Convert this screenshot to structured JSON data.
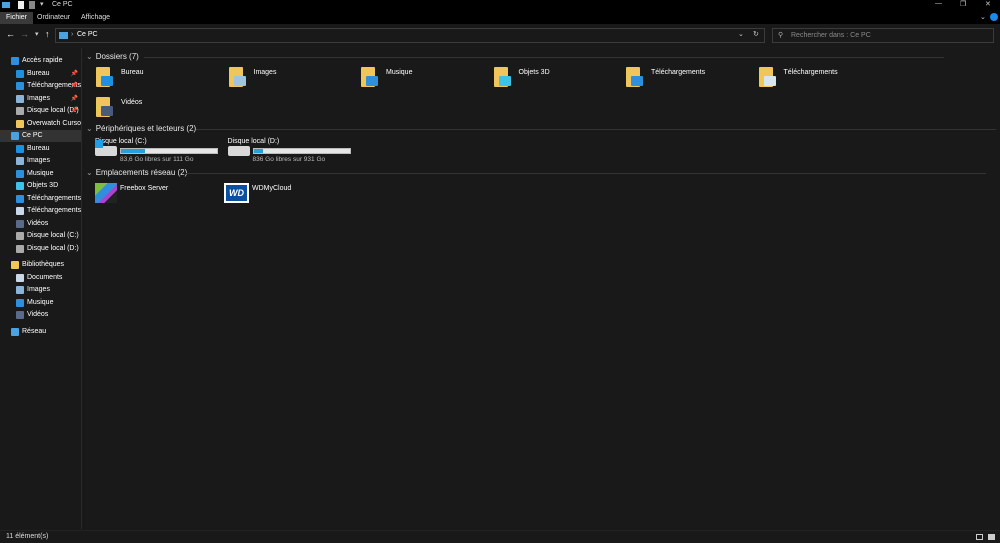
{
  "window": {
    "title": "Ce PC"
  },
  "ribbon": {
    "tabs": [
      "Fichier",
      "Ordinateur",
      "Affichage"
    ]
  },
  "address": {
    "path": "Ce PC",
    "search_placeholder": "Rechercher dans : Ce PC"
  },
  "sidebar": {
    "items": [
      {
        "label": "Accès rapide",
        "icon": "star-icon",
        "color": "#2f8fdc",
        "level": 0,
        "pinned": false
      },
      {
        "label": "Bureau",
        "icon": "desktop-icon",
        "color": "#1e90e0",
        "level": 1,
        "pinned": true
      },
      {
        "label": "Téléchargements",
        "icon": "download-icon",
        "color": "#2f8fdc",
        "level": 1,
        "pinned": true
      },
      {
        "label": "Images",
        "icon": "pictures-icon",
        "color": "#8ab4d8",
        "level": 1,
        "pinned": true
      },
      {
        "label": "Disque local (D:)",
        "icon": "drive-icon",
        "color": "#aaaaaa",
        "level": 1,
        "pinned": true
      },
      {
        "label": "Overwatch Cursor H",
        "icon": "folder-icon",
        "color": "#f0c65a",
        "level": 1,
        "pinned": false
      },
      {
        "label": "Ce PC",
        "icon": "computer-icon",
        "color": "#4aa3e0",
        "level": 0,
        "pinned": false,
        "selected": true
      },
      {
        "label": "Bureau",
        "icon": "desktop-icon",
        "color": "#1e90e0",
        "level": 1
      },
      {
        "label": "Images",
        "icon": "pictures-icon",
        "color": "#8ab4d8",
        "level": 1
      },
      {
        "label": "Musique",
        "icon": "music-icon",
        "color": "#2f8fdc",
        "level": 1
      },
      {
        "label": "Objets 3D",
        "icon": "3d-objects-icon",
        "color": "#3bc4e8",
        "level": 1
      },
      {
        "label": "Téléchargements",
        "icon": "download-icon",
        "color": "#2f8fdc",
        "level": 1
      },
      {
        "label": "Téléchargements",
        "icon": "document-icon",
        "color": "#c8d8e8",
        "level": 1
      },
      {
        "label": "Vidéos",
        "icon": "video-icon",
        "color": "#5a6a8a",
        "level": 1
      },
      {
        "label": "Disque local (C:)",
        "icon": "drive-icon",
        "color": "#aaaaaa",
        "level": 1
      },
      {
        "label": "Disque local (D:)",
        "icon": "drive-icon",
        "color": "#aaaaaa",
        "level": 1
      },
      {
        "label": "Bibliothèques",
        "icon": "libraries-icon",
        "color": "#f0c65a",
        "level": 0,
        "gap": true
      },
      {
        "label": "Documents",
        "icon": "document-icon",
        "color": "#c8d8e8",
        "level": 1
      },
      {
        "label": "Images",
        "icon": "pictures-icon",
        "color": "#8ab4d8",
        "level": 1
      },
      {
        "label": "Musique",
        "icon": "music-icon",
        "color": "#2f8fdc",
        "level": 1
      },
      {
        "label": "Vidéos",
        "icon": "video-icon",
        "color": "#5a6a8a",
        "level": 1
      },
      {
        "label": "Réseau",
        "icon": "network-icon",
        "color": "#4aa3e0",
        "level": 0,
        "gap": true
      }
    ]
  },
  "sections": {
    "folders": "Dossiers (7)",
    "drives": "Périphériques et lecteurs (2)",
    "network": "Emplacements réseau (2)"
  },
  "folders": [
    {
      "name": "Bureau",
      "overlay": "#1e90e0"
    },
    {
      "name": "Images",
      "overlay": "#9ec4e0"
    },
    {
      "name": "Musique",
      "overlay": "#2f8fdc"
    },
    {
      "name": "Objets 3D",
      "overlay": "#3bc4e8"
    },
    {
      "name": "Téléchargements",
      "overlay": "#2f8fdc"
    },
    {
      "name": "Téléchargements",
      "overlay": "#d8e4f0"
    },
    {
      "name": "Vidéos",
      "overlay": "#4a5a7a"
    }
  ],
  "drives": [
    {
      "name": "Disque local (C:)",
      "free": "83,6 Go libres sur 111 Go",
      "used_fraction": 0.25
    },
    {
      "name": "Disque local (D:)",
      "free": "836 Go libres sur 931 Go",
      "used_fraction": 0.1
    }
  ],
  "network": [
    {
      "name": "Freebox Server"
    },
    {
      "name": "WDMyCloud",
      "logo": "WD"
    }
  ],
  "status": {
    "count": "11 élément(s)"
  }
}
